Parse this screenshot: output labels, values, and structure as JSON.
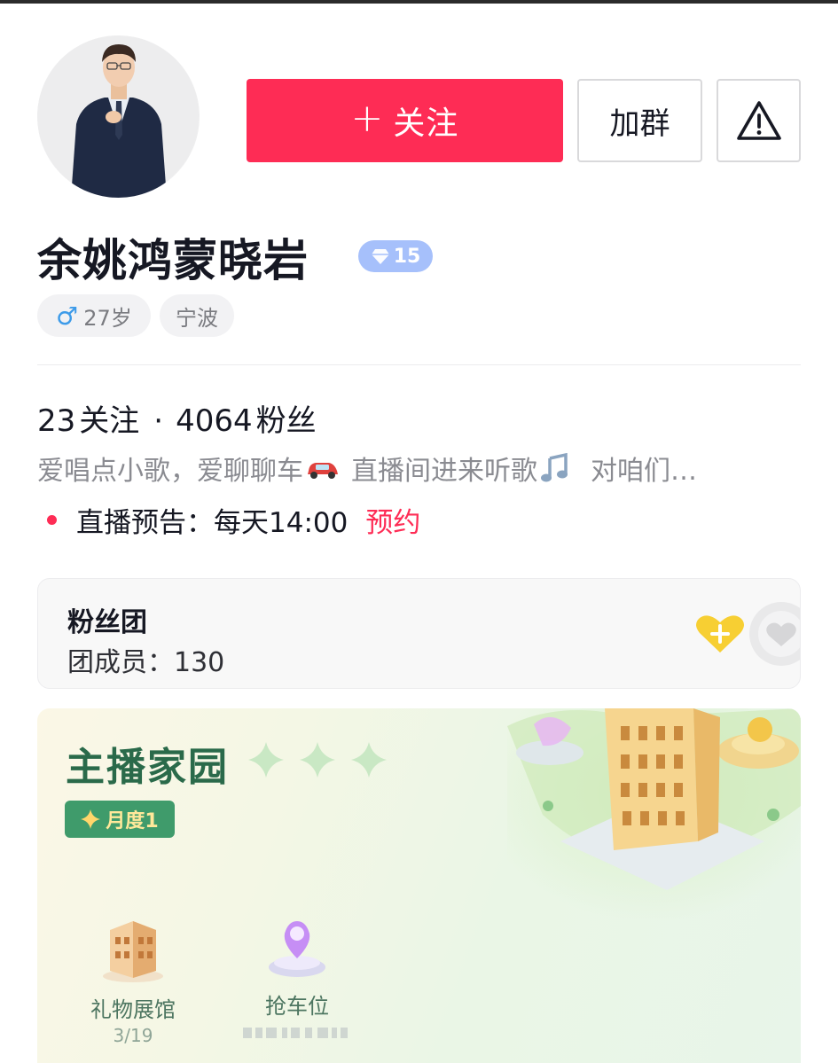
{
  "profile": {
    "name": "余姚鸿蒙晓岩",
    "level": "15",
    "age_tag": "27岁",
    "gender_symbol": "♂",
    "city_tag": "宁波"
  },
  "actions": {
    "follow_label": "关注",
    "follow_plus": "+",
    "group_label": "加群",
    "report_icon": "warning-triangle-icon"
  },
  "stats": {
    "following_count": "23",
    "following_label": "关注",
    "separator": "·",
    "followers_count": "4064",
    "followers_label": "粉丝"
  },
  "bio": {
    "part1": "爱唱点小歌，爱聊聊车",
    "part2": "直播间进来听歌",
    "part3": "对咱们…",
    "icons": [
      "car-emoji-icon",
      "music-note-icon"
    ]
  },
  "live_notice": {
    "text": "直播预告：每天14:00",
    "action": "预约"
  },
  "fan_club": {
    "title": "粉丝团",
    "members_label": "团成员：130"
  },
  "anchor_home": {
    "title": "主播家园",
    "badge": "月度1",
    "items": [
      {
        "label": "礼物展馆",
        "sub": "3/19"
      },
      {
        "label": "抢车位",
        "sub": ""
      }
    ]
  },
  "colors": {
    "accent": "#fe2c55",
    "level_badge": "#a6c0fb",
    "home_title": "#2a6a4a",
    "month_badge": "#3f9b6b"
  }
}
